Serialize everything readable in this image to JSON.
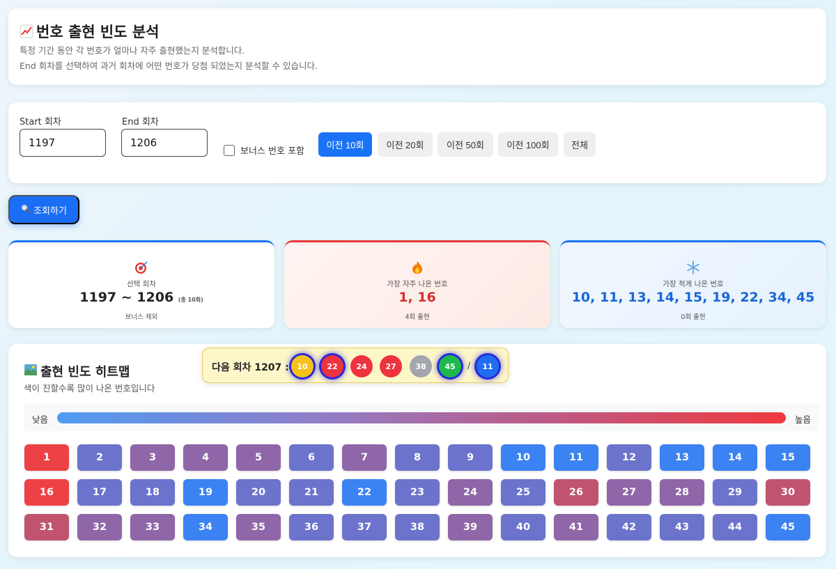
{
  "header": {
    "title": "번호 출현 빈도 분석",
    "desc1": "특정 기간 동안 각 번호가 얼마나 자주 출현했는지 분석합니다.",
    "desc2": "End 회차를 선택하여 과거 회차에 어떤 번호가 당첨 되었는지 분석할 수 있습니다."
  },
  "filter": {
    "start_label": "Start 회차",
    "start_value": "1197",
    "end_label": "End 회차",
    "end_value": "1206",
    "bonus_label": "보너스 번호 포함",
    "bonus_checked": false,
    "ranges": [
      "이전 10회",
      "이전 20회",
      "이전 50회",
      "이전 100회",
      "전체"
    ],
    "active_range": "이전 10회"
  },
  "search_button": "조회하기",
  "stats": {
    "range": {
      "label": "선택 회차",
      "value": "1197 ~ 1206",
      "note": "(총 10회)",
      "sub": "보너스 제외"
    },
    "hot": {
      "label": "가장 자주 나온 번호",
      "value": "1, 16",
      "sub": "4회 출현"
    },
    "cold": {
      "label": "가장 적게 나온 번호",
      "value": "10, 11, 13, 14, 15, 19, 22, 34, 45",
      "sub": "0회 출현"
    }
  },
  "heatmap": {
    "title": "출현 빈도 히트맵",
    "desc": "색이 진할수록 많이 나온 번호입니다",
    "legend_low": "낮음",
    "legend_high": "높음",
    "colors": {
      "0": "#3b82f2",
      "1": "#6b73cc",
      "2": "#8f66a8",
      "3": "#c0536e",
      "4": "#ed4245"
    },
    "levels": [
      4,
      1,
      2,
      2,
      2,
      1,
      2,
      1,
      1,
      0,
      0,
      1,
      0,
      0,
      0,
      4,
      1,
      1,
      0,
      1,
      1,
      0,
      1,
      2,
      1,
      3,
      2,
      2,
      1,
      3,
      3,
      2,
      2,
      0,
      2,
      1,
      1,
      1,
      2,
      1,
      2,
      1,
      1,
      1,
      0
    ]
  },
  "next_draw": {
    "label": "다음 회차 1207 :",
    "balls": [
      {
        "num": "10",
        "color": "#f6c21a",
        "glow": true
      },
      {
        "num": "22",
        "color": "#ee3340",
        "glow": true
      },
      {
        "num": "24",
        "color": "#ee3340",
        "glow": false
      },
      {
        "num": "27",
        "color": "#ee3340",
        "glow": false
      },
      {
        "num": "38",
        "color": "#a3a6ad",
        "glow": false
      },
      {
        "num": "45",
        "color": "#1fb84f",
        "glow": true
      }
    ],
    "separator": "/",
    "bonus": {
      "num": "11",
      "color": "#1f6df0",
      "glow": true
    }
  }
}
